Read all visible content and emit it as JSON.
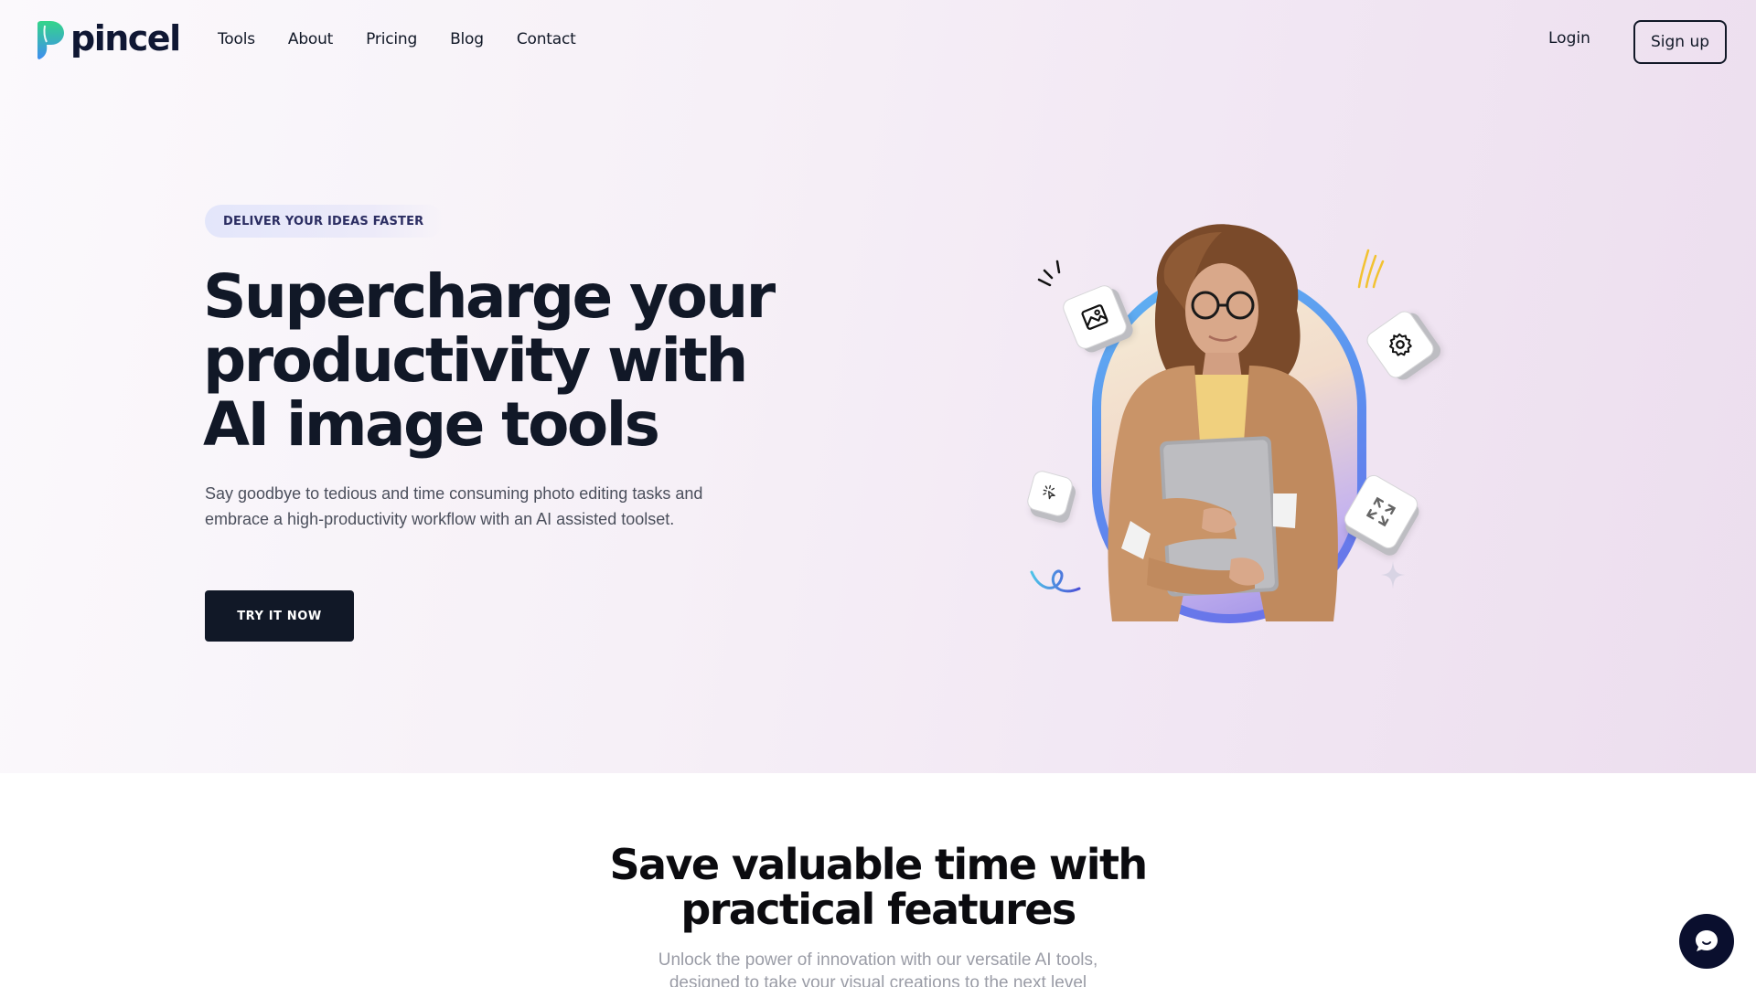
{
  "brand": {
    "name": "pincel",
    "logo_icon": "pincel-p-logo-icon",
    "accent": "#2ecc8f"
  },
  "nav": {
    "items": [
      {
        "label": "Tools"
      },
      {
        "label": "About"
      },
      {
        "label": "Pricing"
      },
      {
        "label": "Blog"
      },
      {
        "label": "Contact"
      }
    ],
    "login_label": "Login",
    "signup_label": "Sign up"
  },
  "hero": {
    "badge": "DELIVER YOUR IDEAS FASTER",
    "headline_lines": [
      "Supercharge your",
      "productivity with",
      "AI image tools"
    ],
    "subtext": "Say goodbye to tedious and time consuming photo editing tasks and embrace a high-productivity workflow with an AI assisted toolset.",
    "cta_label": "TRY IT NOW",
    "illustration": {
      "subject": "woman-holding-laptop",
      "tiles": [
        "image-icon",
        "gear-icon",
        "magic-cursor-icon",
        "expand-arrows-icon"
      ]
    }
  },
  "features": {
    "title_lines": [
      "Save valuable time with",
      "practical features"
    ],
    "subtitle_lines": [
      "Unlock the power of innovation with our versatile AI tools,",
      "designed to take your visual creations to the next level"
    ]
  },
  "chat": {
    "icon": "chat-bubble-icon"
  },
  "colors": {
    "text_dark": "#111827",
    "cta_bg": "#111827",
    "badge_bg": "#e3e6fa",
    "badge_text": "#2b2d62",
    "chat_bg": "#0a0f2e"
  }
}
